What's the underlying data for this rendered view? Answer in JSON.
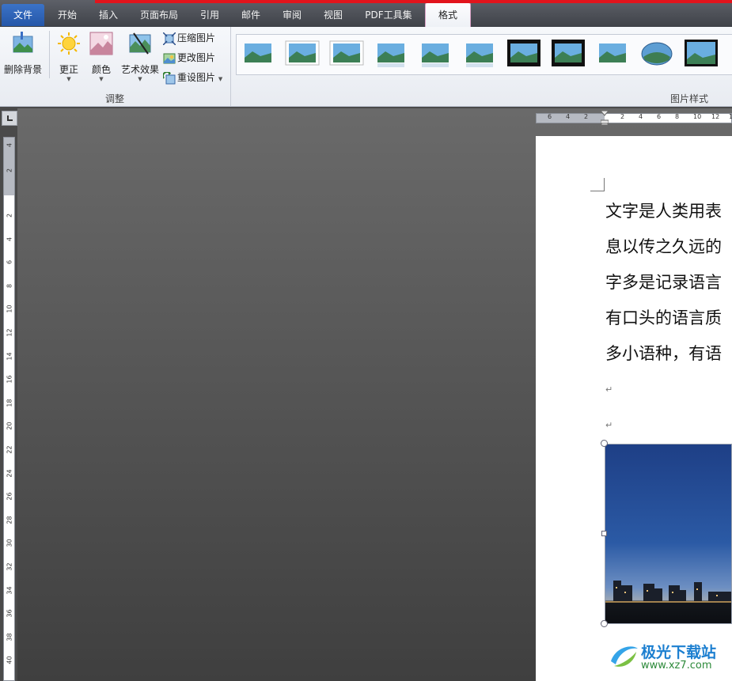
{
  "tabs": [
    {
      "label": "文件"
    },
    {
      "label": "开始"
    },
    {
      "label": "插入"
    },
    {
      "label": "页面布局"
    },
    {
      "label": "引用"
    },
    {
      "label": "邮件"
    },
    {
      "label": "审阅"
    },
    {
      "label": "视图"
    },
    {
      "label": "PDF工具集"
    },
    {
      "label": "格式"
    }
  ],
  "active_tab": "格式",
  "ribbon": {
    "adjust": {
      "remove_bg": "删除背景",
      "corrections": "更正",
      "color": "颜色",
      "artistic": "艺术效果",
      "compress": "压缩图片",
      "change": "更改图片",
      "reset": "重设图片",
      "group_label": "调整"
    },
    "styles": {
      "group_label": "图片样式",
      "thumb_count": 11
    }
  },
  "ruler": {
    "horizontal": [
      "6",
      "4",
      "2",
      "2",
      "4",
      "6",
      "8",
      "10",
      "12",
      "14"
    ],
    "vertical": [
      "4",
      "2",
      "2",
      "4",
      "6",
      "8",
      "10",
      "12",
      "14",
      "16",
      "18",
      "20",
      "22",
      "24",
      "26",
      "28",
      "30",
      "32",
      "34",
      "36",
      "38",
      "40"
    ]
  },
  "document": {
    "lines": [
      "文字是人类用表",
      "息以传之久远的",
      "字多是记录语言",
      "有口头的语言质",
      "多小语种，有语"
    ],
    "para_mark": "↵"
  },
  "watermark": {
    "title": "极光下载站",
    "url": "www.xz7.com"
  },
  "colors": {
    "accent_red": "#e2141c",
    "file_tab": "#2d62b6",
    "watermark_blue": "#1c7fd0",
    "watermark_green": "#2d8a3a"
  }
}
